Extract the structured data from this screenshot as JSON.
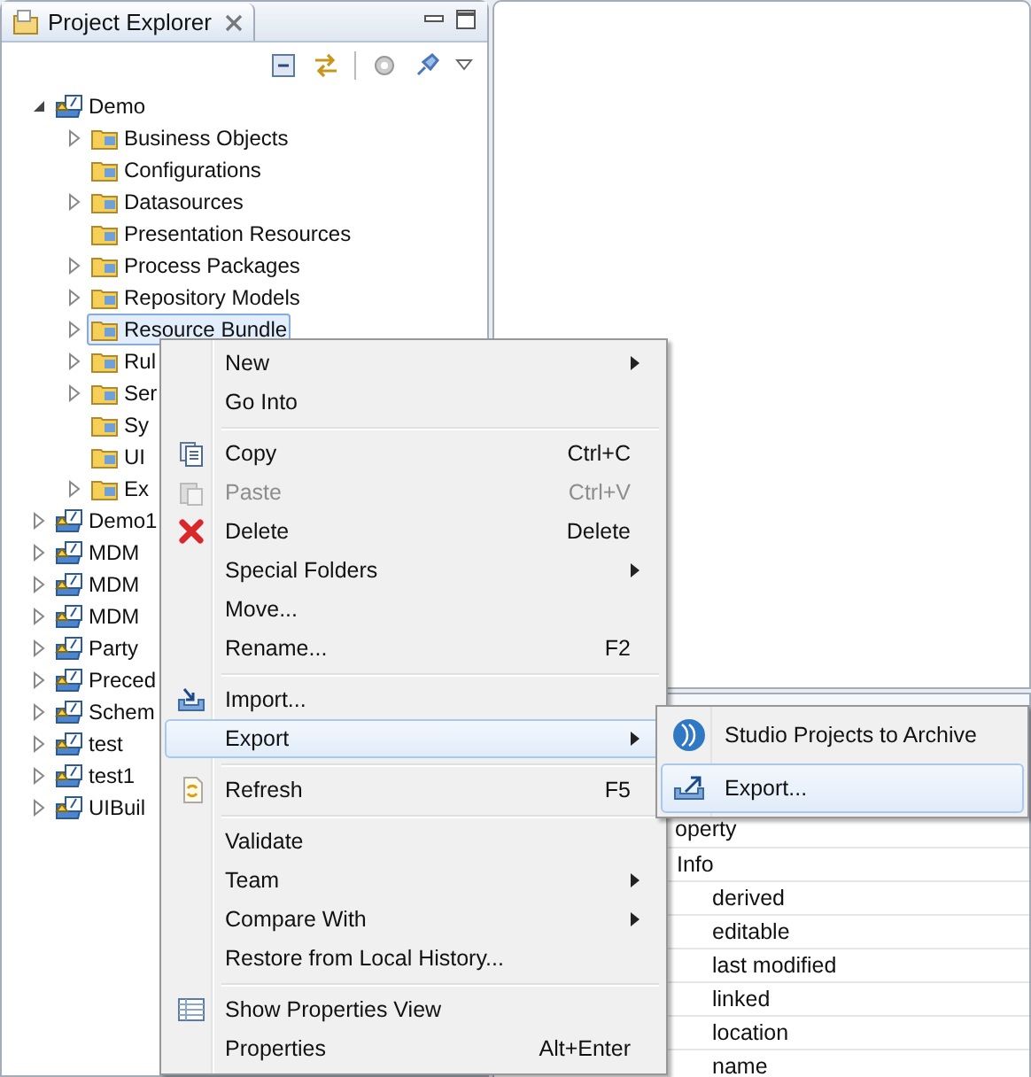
{
  "explorer": {
    "title": "Project Explorer",
    "tree": [
      {
        "label": "Demo",
        "kind": "project",
        "expanded": true,
        "selected": false,
        "children": [
          {
            "label": "Business Objects",
            "kind": "folder",
            "expanded": false,
            "selected": false
          },
          {
            "label": "Configurations",
            "kind": "folder",
            "selected": false
          },
          {
            "label": "Datasources",
            "kind": "folder",
            "expanded": false,
            "selected": false
          },
          {
            "label": "Presentation Resources",
            "kind": "folder",
            "selected": false
          },
          {
            "label": "Process Packages",
            "kind": "folder",
            "expanded": false,
            "selected": false
          },
          {
            "label": "Repository Models",
            "kind": "folder",
            "expanded": false,
            "selected": false
          },
          {
            "label": "Resource Bundle",
            "kind": "folder",
            "expanded": false,
            "selected": true
          },
          {
            "label": "Rul",
            "kind": "folder",
            "expanded": false,
            "selected": false
          },
          {
            "label": "Ser",
            "kind": "folder",
            "expanded": false,
            "selected": false
          },
          {
            "label": "Sy",
            "kind": "folder",
            "selected": false
          },
          {
            "label": "UI",
            "kind": "folder",
            "selected": false
          },
          {
            "label": "Ex",
            "kind": "folder",
            "expanded": false,
            "selected": false
          }
        ]
      },
      {
        "label": "Demo1",
        "kind": "project",
        "expanded": false,
        "selected": false
      },
      {
        "label": "MDM",
        "kind": "project",
        "expanded": false,
        "selected": false
      },
      {
        "label": "MDM",
        "kind": "project",
        "expanded": false,
        "selected": false
      },
      {
        "label": "MDM",
        "kind": "project",
        "expanded": false,
        "selected": false
      },
      {
        "label": "Party",
        "kind": "project",
        "expanded": false,
        "selected": false
      },
      {
        "label": "Preced",
        "kind": "project",
        "expanded": false,
        "selected": false
      },
      {
        "label": "Schem",
        "kind": "project",
        "expanded": false,
        "selected": false
      },
      {
        "label": "test",
        "kind": "project",
        "expanded": false,
        "selected": false
      },
      {
        "label": "test1",
        "kind": "project",
        "expanded": false,
        "selected": false
      },
      {
        "label": "UIBuil",
        "kind": "project",
        "expanded": false,
        "selected": false
      }
    ]
  },
  "properties": {
    "header": "operty",
    "rows": [
      {
        "label": "Info",
        "children": [
          {
            "label": "derived"
          },
          {
            "label": "editable"
          },
          {
            "label": "last modified"
          },
          {
            "label": "linked"
          },
          {
            "label": "location"
          },
          {
            "label": "name"
          }
        ]
      }
    ]
  },
  "context_menu": {
    "items": [
      {
        "kind": "item",
        "label": "New",
        "submenu": true,
        "disabled": false,
        "selected": false
      },
      {
        "kind": "item",
        "label": "Go Into",
        "submenu": false,
        "disabled": false,
        "selected": false
      },
      {
        "kind": "separator"
      },
      {
        "kind": "item",
        "label": "Copy",
        "shortcut": "Ctrl+C",
        "submenu": false,
        "disabled": false,
        "selected": false
      },
      {
        "kind": "item",
        "label": "Paste",
        "shortcut": "Ctrl+V",
        "submenu": false,
        "disabled": true,
        "selected": false
      },
      {
        "kind": "item",
        "label": "Delete",
        "shortcut": "Delete",
        "submenu": false,
        "disabled": false,
        "selected": false
      },
      {
        "kind": "item",
        "label": "Special Folders",
        "submenu": true,
        "disabled": false,
        "selected": false
      },
      {
        "kind": "item",
        "label": "Move...",
        "submenu": false,
        "disabled": false,
        "selected": false
      },
      {
        "kind": "item",
        "label": "Rename...",
        "shortcut": "F2",
        "submenu": false,
        "disabled": false,
        "selected": false
      },
      {
        "kind": "separator"
      },
      {
        "kind": "item",
        "label": "Import...",
        "submenu": false,
        "disabled": false,
        "selected": false
      },
      {
        "kind": "item",
        "label": "Export",
        "submenu": true,
        "disabled": false,
        "selected": true
      },
      {
        "kind": "separator"
      },
      {
        "kind": "item",
        "label": "Refresh",
        "shortcut": "F5",
        "submenu": false,
        "disabled": false,
        "selected": false
      },
      {
        "kind": "separator"
      },
      {
        "kind": "item",
        "label": "Validate",
        "submenu": false,
        "disabled": false,
        "selected": false
      },
      {
        "kind": "item",
        "label": "Team",
        "submenu": true,
        "disabled": false,
        "selected": false
      },
      {
        "kind": "item",
        "label": "Compare With",
        "submenu": true,
        "disabled": false,
        "selected": false
      },
      {
        "kind": "item",
        "label": "Restore from Local History...",
        "submenu": false,
        "disabled": false,
        "selected": false
      },
      {
        "kind": "separator"
      },
      {
        "kind": "item",
        "label": "Show Properties View",
        "submenu": false,
        "disabled": false,
        "selected": false
      },
      {
        "kind": "item",
        "label": "Properties",
        "shortcut": "Alt+Enter",
        "submenu": false,
        "disabled": false,
        "selected": false
      }
    ]
  },
  "submenu": {
    "items": [
      {
        "label": "Studio Projects to Archive",
        "selected": false
      },
      {
        "label": "Export...",
        "selected": true
      }
    ]
  }
}
